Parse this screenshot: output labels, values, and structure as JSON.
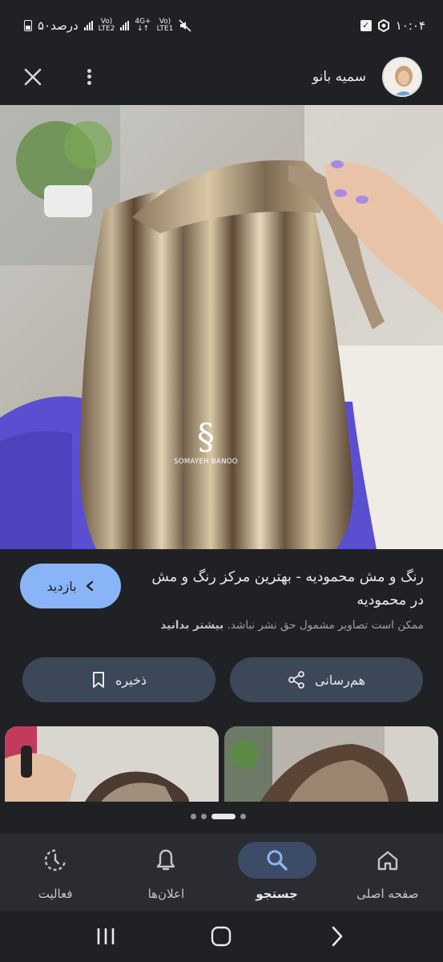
{
  "status_bar": {
    "time": "۱۰:۰۴",
    "battery": "۵۰درصد",
    "sim1_label": "Vo) LTE2",
    "sim2_label": "4G+ Vo) LTE1"
  },
  "header": {
    "site_name": "سمیه بانو"
  },
  "hero": {
    "watermark_text": "SOMAYEH BANOO"
  },
  "info": {
    "title": "رنگ و مش محمودیه - بهترین مرکز رنگ و مش در محمودیه",
    "notice": "ممکن است تصاویر مشمول حق نشر نباشد.",
    "learn_more": "بیشتر بدانید",
    "visit_label": "بازدید"
  },
  "actions": {
    "share_label": "هم‌رسانی",
    "save_label": "ذخیره"
  },
  "carousel": {
    "count": 4,
    "active_index": 2
  },
  "bottom_nav": {
    "items": [
      {
        "label": "فعالیت",
        "icon": "activity-icon"
      },
      {
        "label": "اعلان‌ها",
        "icon": "bell-icon"
      },
      {
        "label": "جستجو",
        "icon": "search-icon",
        "active": true
      },
      {
        "label": "صفحه اصلی",
        "icon": "home-icon"
      }
    ]
  },
  "colors": {
    "background": "#202124",
    "accent": "#8ab4f8",
    "action_button": "#3c4758",
    "active_nav": "#3d4c66"
  }
}
